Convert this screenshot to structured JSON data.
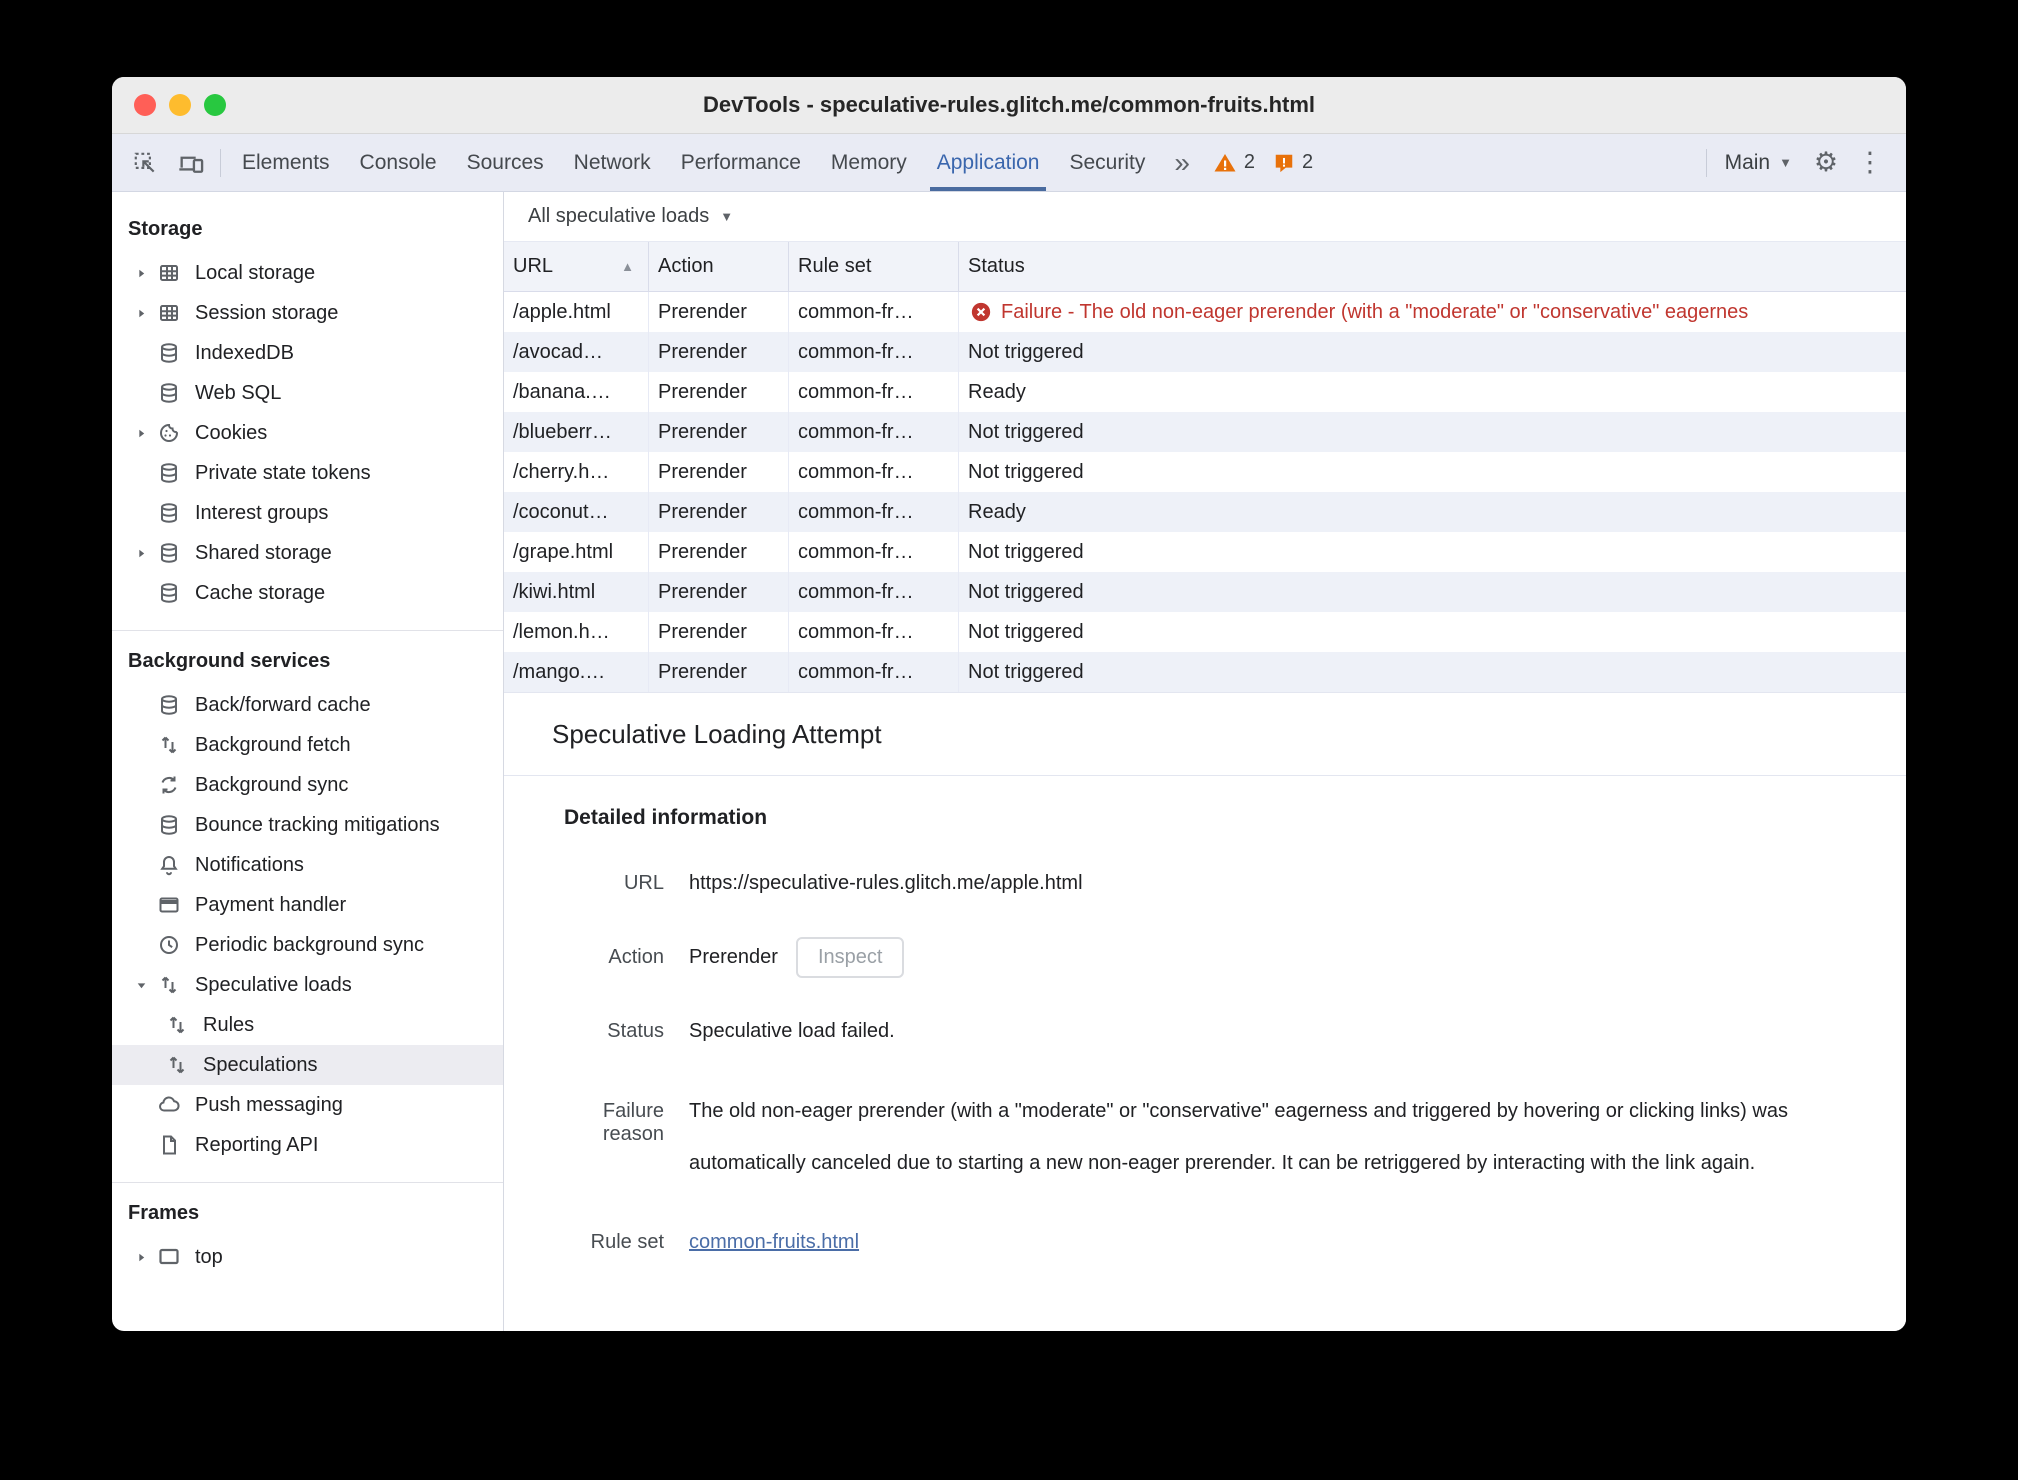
{
  "colors": {
    "accent_blue": "#3a66ad",
    "failure_red": "#c0362f",
    "warning_orange": "#e8710a",
    "link_blue": "#4a6da7",
    "selected_row_bg": "#ececf1",
    "alt_row_bg": "#eef1f8"
  },
  "window": {
    "title": "DevTools - speculative-rules.glitch.me/common-fruits.html"
  },
  "tabbar": {
    "tabs": [
      {
        "label": "Elements"
      },
      {
        "label": "Console"
      },
      {
        "label": "Sources"
      },
      {
        "label": "Network"
      },
      {
        "label": "Performance"
      },
      {
        "label": "Memory"
      },
      {
        "label": "Application"
      },
      {
        "label": "Security"
      }
    ],
    "overflow_label": "»",
    "warnings_count": "2",
    "issues_count": "2",
    "target_label": "Main",
    "target_caret": "▼",
    "gear_glyph": "⚙",
    "kebab_glyph": "⋮"
  },
  "sidebar": {
    "sections": [
      {
        "title": "Storage",
        "items": [
          {
            "label": "Local storage"
          },
          {
            "label": "Session storage"
          },
          {
            "label": "IndexedDB"
          },
          {
            "label": "Web SQL"
          },
          {
            "label": "Cookies"
          },
          {
            "label": "Private state tokens"
          },
          {
            "label": "Interest groups"
          },
          {
            "label": "Shared storage"
          },
          {
            "label": "Cache storage"
          }
        ]
      },
      {
        "title": "Background services",
        "items": [
          {
            "label": "Back/forward cache"
          },
          {
            "label": "Background fetch"
          },
          {
            "label": "Background sync"
          },
          {
            "label": "Bounce tracking mitigations"
          },
          {
            "label": "Notifications"
          },
          {
            "label": "Payment handler"
          },
          {
            "label": "Periodic background sync"
          },
          {
            "label": "Speculative loads"
          },
          {
            "label": "Rules"
          },
          {
            "label": "Speculations"
          },
          {
            "label": "Push messaging"
          },
          {
            "label": "Reporting API"
          }
        ]
      },
      {
        "title": "Frames",
        "items": [
          {
            "label": "top"
          }
        ]
      }
    ]
  },
  "toolbar": {
    "filter_label": "All speculative loads",
    "filter_caret": "▼"
  },
  "table": {
    "columns": [
      "URL",
      "Action",
      "Rule set",
      "Status"
    ],
    "sort_arrow": "▲",
    "rows": [
      {
        "url": "/apple.html",
        "action": "Prerender",
        "rule_set": "common-fr…",
        "status": "Failure - The old non-eager prerender (with a \"moderate\" or \"conservative\" eagernes"
      },
      {
        "url": "/avocad…",
        "action": "Prerender",
        "rule_set": "common-fr…",
        "status": "Not triggered"
      },
      {
        "url": "/banana.…",
        "action": "Prerender",
        "rule_set": "common-fr…",
        "status": "Ready"
      },
      {
        "url": "/blueberr…",
        "action": "Prerender",
        "rule_set": "common-fr…",
        "status": "Not triggered"
      },
      {
        "url": "/cherry.h…",
        "action": "Prerender",
        "rule_set": "common-fr…",
        "status": "Not triggered"
      },
      {
        "url": "/coconut…",
        "action": "Prerender",
        "rule_set": "common-fr…",
        "status": "Ready"
      },
      {
        "url": "/grape.html",
        "action": "Prerender",
        "rule_set": "common-fr…",
        "status": "Not triggered"
      },
      {
        "url": "/kiwi.html",
        "action": "Prerender",
        "rule_set": "common-fr…",
        "status": "Not triggered"
      },
      {
        "url": "/lemon.h…",
        "action": "Prerender",
        "rule_set": "common-fr…",
        "status": "Not triggered"
      },
      {
        "url": "/mango.…",
        "action": "Prerender",
        "rule_set": "common-fr…",
        "status": "Not triggered"
      }
    ]
  },
  "details": {
    "title": "Speculative Loading Attempt",
    "section_title": "Detailed information",
    "url_label": "URL",
    "url": "https://speculative-rules.glitch.me/apple.html",
    "action_label": "Action",
    "action": "Prerender",
    "inspect_button": "Inspect",
    "status_label": "Status",
    "status": "Speculative load failed.",
    "failure_label": "Failure reason",
    "failure_reason": "The old non-eager prerender (with a \"moderate\" or \"conservative\" eagerness and triggered by hovering or clicking links) was automatically canceled due to starting a new non-eager prerender. It can be retriggered by interacting with the link again.",
    "rule_set_label": "Rule set",
    "rule_set_link": "common-fruits.html"
  }
}
